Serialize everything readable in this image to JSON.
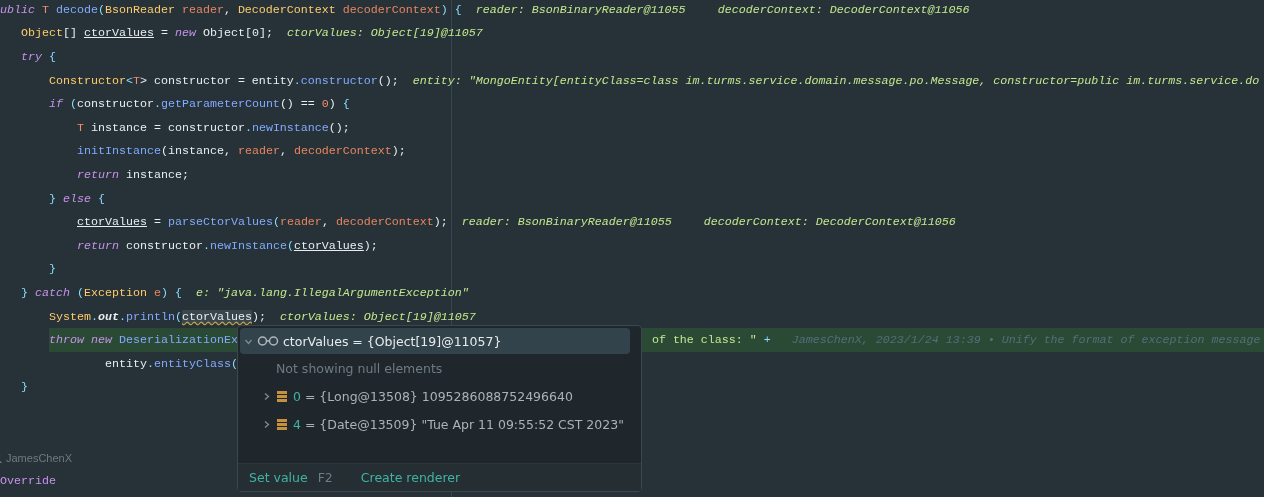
{
  "editor": {
    "lines": [
      {
        "code": [
          {
            "text": "ublic",
            "kind": "keyword"
          },
          {
            "text": " T",
            "kind": "typeparam"
          },
          {
            "text": " decode",
            "kind": "method"
          },
          {
            "text": "(",
            "kind": "punct"
          },
          {
            "text": "BsonReader",
            "kind": "type"
          },
          {
            "text": " reader",
            "kind": "param"
          },
          {
            "text": ", ",
            "kind": "plain"
          },
          {
            "text": "DecoderContext",
            "kind": "type"
          },
          {
            "text": " decoderContext",
            "kind": "param"
          },
          {
            "text": ")",
            "kind": "punct"
          },
          {
            "text": " {",
            "kind": "punct"
          }
        ],
        "hints": [
          "reader: BsonBinaryReader@11055",
          "decoderContext: DecoderContext@11056"
        ],
        "highlighted": false,
        "children": [
          {
            "code": [
              {
                "text": "Object",
                "kind": "type"
              },
              {
                "text": "[] ",
                "kind": "plain"
              },
              {
                "text": "ctorValues",
                "kind": "localvar"
              },
              {
                "text": " = ",
                "kind": "plain"
              },
              {
                "text": "new",
                "kind": "keyword"
              },
              {
                "text": " Object[0];",
                "kind": "plain"
              }
            ],
            "hints": [
              "ctorValues: Object[19]@11057"
            ],
            "highlighted": false
          },
          {
            "code": [
              {
                "text": "try",
                "kind": "keyword"
              },
              {
                "text": " {",
                "kind": "punct"
              }
            ],
            "highlighted": false,
            "children": [
              {
                "code": [
                  {
                    "text": "Constructor",
                    "kind": "type"
                  },
                  {
                    "text": "<",
                    "kind": "punct"
                  },
                  {
                    "text": "T",
                    "kind": "typeparam"
                  },
                  {
                    "text": "> constructor = entity",
                    "kind": "plain"
                  },
                  {
                    "text": ".",
                    "kind": "punct"
                  },
                  {
                    "text": "constructor",
                    "kind": "method"
                  },
                  {
                    "text": "();",
                    "kind": "plain"
                  }
                ],
                "hints": [
                  "entity: \"MongoEntity[entityClass=class im.turms.service.domain.message.po.Message, constructor=public im.turms.service.do"
                ],
                "highlighted": false
              },
              {
                "code": [
                  {
                    "text": "if",
                    "kind": "keyword"
                  },
                  {
                    "text": " (",
                    "kind": "punct"
                  },
                  {
                    "text": "constructor",
                    "kind": "plain"
                  },
                  {
                    "text": ".",
                    "kind": "punct"
                  },
                  {
                    "text": "getParameterCount",
                    "kind": "method"
                  },
                  {
                    "text": "() == ",
                    "kind": "plain"
                  },
                  {
                    "text": "0",
                    "kind": "number"
                  },
                  {
                    "text": ") ",
                    "kind": "plain"
                  },
                  {
                    "text": "{",
                    "kind": "punct"
                  }
                ],
                "highlighted": false,
                "children": [
                  {
                    "code": [
                      {
                        "text": "T",
                        "kind": "typeparam"
                      },
                      {
                        "text": " instance = constructor",
                        "kind": "plain"
                      },
                      {
                        "text": ".",
                        "kind": "punct"
                      },
                      {
                        "text": "newInstance",
                        "kind": "method"
                      },
                      {
                        "text": "();",
                        "kind": "plain"
                      }
                    ],
                    "highlighted": false
                  },
                  {
                    "code": [
                      {
                        "text": "initInstance",
                        "kind": "method"
                      },
                      {
                        "text": "(instance, ",
                        "kind": "plain"
                      },
                      {
                        "text": "reader",
                        "kind": "param"
                      },
                      {
                        "text": ", ",
                        "kind": "plain"
                      },
                      {
                        "text": "decoderContext",
                        "kind": "param"
                      },
                      {
                        "text": ");",
                        "kind": "plain"
                      }
                    ],
                    "highlighted": false
                  },
                  {
                    "code": [
                      {
                        "text": "return",
                        "kind": "keyword"
                      },
                      {
                        "text": " instance;",
                        "kind": "plain"
                      }
                    ],
                    "highlighted": false
                  }
                ]
              },
              {
                "code": [
                  {
                    "text": "}",
                    "kind": "punct"
                  },
                  {
                    "text": " else",
                    "kind": "keyword"
                  },
                  {
                    "text": " {",
                    "kind": "punct"
                  }
                ],
                "highlighted": false,
                "children": [
                  {
                    "code": [
                      {
                        "text": "ctorValues",
                        "kind": "localvar"
                      },
                      {
                        "text": " = ",
                        "kind": "plain"
                      },
                      {
                        "text": "parseCtorValues",
                        "kind": "method"
                      },
                      {
                        "text": "(",
                        "kind": "punct"
                      },
                      {
                        "text": "reader",
                        "kind": "param"
                      },
                      {
                        "text": ", ",
                        "kind": "plain"
                      },
                      {
                        "text": "decoderContext",
                        "kind": "param"
                      },
                      {
                        "text": ");",
                        "kind": "plain"
                      }
                    ],
                    "hints": [
                      "reader: BsonBinaryReader@11055",
                      "decoderContext: DecoderContext@11056"
                    ],
                    "highlighted": false
                  },
                  {
                    "code": [
                      {
                        "text": "return",
                        "kind": "keyword"
                      },
                      {
                        "text": " constructor",
                        "kind": "plain"
                      },
                      {
                        "text": ".",
                        "kind": "punct"
                      },
                      {
                        "text": "newInstance",
                        "kind": "method"
                      },
                      {
                        "text": "(",
                        "kind": "punct"
                      },
                      {
                        "text": "ctorValues",
                        "kind": "localvar"
                      },
                      {
                        "text": ");",
                        "kind": "plain"
                      }
                    ],
                    "highlighted": false
                  }
                ]
              },
              {
                "code": [
                  {
                    "text": "}",
                    "kind": "punct"
                  }
                ],
                "highlighted": false
              }
            ]
          },
          {
            "code": [
              {
                "text": "}",
                "kind": "punct"
              },
              {
                "text": " catch",
                "kind": "keyword"
              },
              {
                "text": " (",
                "kind": "punct"
              },
              {
                "text": "Exception",
                "kind": "type"
              },
              {
                "text": " e",
                "kind": "param"
              },
              {
                "text": ") ",
                "kind": "punct"
              },
              {
                "text": "{",
                "kind": "punct"
              }
            ],
            "hints": [
              "e: \"java.lang.IllegalArgumentException\""
            ],
            "highlighted": false,
            "children": [
              {
                "code": [
                  {
                    "text": "System",
                    "kind": "type"
                  },
                  {
                    "text": ".",
                    "kind": "punct"
                  },
                  {
                    "text": "out",
                    "kind": "static"
                  },
                  {
                    "text": ".",
                    "kind": "punct"
                  },
                  {
                    "text": "println",
                    "kind": "method"
                  },
                  {
                    "text": "(",
                    "kind": "punct"
                  },
                  {
                    "text": "ctorValues",
                    "kind": "hovered"
                  },
                  {
                    "text": ");",
                    "kind": "plain"
                  }
                ],
                "hints": [
                  "ctorValues: Object[19]@11057"
                ],
                "highlighted": false
              },
              {
                "code": [
                  {
                    "text": "throw",
                    "kind": "keyword"
                  },
                  {
                    "text": " new",
                    "kind": "keyword"
                  },
                  {
                    "text": " DeserializationEx",
                    "kind": "method"
                  }
                ],
                "code_after": [
                  {
                    "text": "of the class: \"",
                    "kind": "string"
                  },
                  {
                    "text": " +",
                    "kind": "punct"
                  }
                ],
                "blame": "JamesChenX, 2023/1/24 13:39 • Unify the format of exception message",
                "highlighted": true,
                "children": [
                  {
                    "code": [
                      {
                        "text": "entity",
                        "kind": "plain"
                      },
                      {
                        "text": ".",
                        "kind": "punct"
                      },
                      {
                        "text": "entityClass",
                        "kind": "method"
                      },
                      {
                        "text": "(",
                        "kind": "punct"
                      }
                    ],
                    "highlighted": false
                  }
                ]
              }
            ]
          },
          {
            "code": [
              {
                "text": "}",
                "kind": "punct"
              }
            ],
            "highlighted": false
          }
        ]
      }
    ],
    "code_vision": {
      "author": "JamesChenX"
    },
    "last_line": "Override"
  },
  "debug_popup": {
    "header": {
      "expanded": true,
      "text": "ctorValues = {Object[19]@11057}"
    },
    "note": "Not showing null elements",
    "children": [
      {
        "index": "0",
        "value": " = {Long@13508} 1095286088752496640",
        "expanded": false
      },
      {
        "index": "4",
        "value": " = {Date@13509} \"Tue Apr 11 09:55:52 CST 2023\"",
        "expanded": false
      }
    ],
    "actions": [
      {
        "label": "Set value",
        "shortcut": "F2"
      },
      {
        "label": "Create renderer"
      }
    ]
  }
}
